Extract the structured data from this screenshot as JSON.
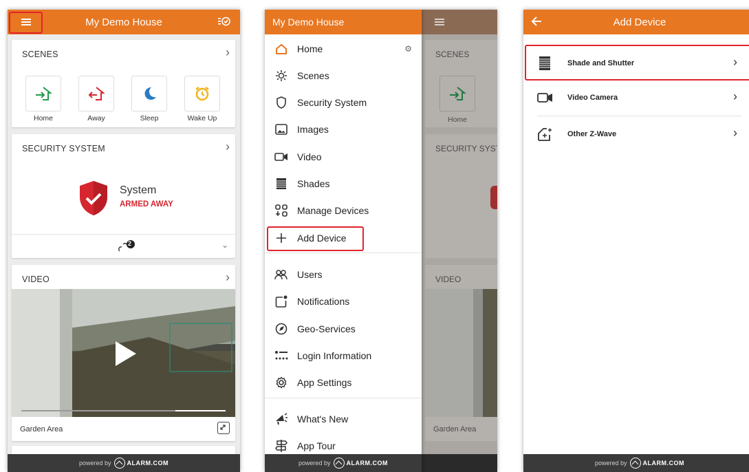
{
  "colors": {
    "brand": "#e87722",
    "armed": "#d6262f",
    "highlight": "#e0242b",
    "scene_green": "#1f9a4a",
    "scene_red": "#d6262f",
    "scene_blue": "#2b7bc4",
    "scene_yellow": "#f2b31b"
  },
  "footer": {
    "powered_by": "powered by",
    "brand": "ALARM.COM"
  },
  "screen1": {
    "title": "My Demo House",
    "icons": {
      "menu": "hamburger-icon",
      "status": "list-check-icon"
    },
    "scenes": {
      "heading": "SCENES",
      "items": [
        {
          "label": "Home",
          "icon": "home-enter-icon"
        },
        {
          "label": "Away",
          "icon": "home-leave-icon"
        },
        {
          "label": "Sleep",
          "icon": "moon-icon"
        },
        {
          "label": "Wake Up",
          "icon": "alarm-clock-icon"
        }
      ]
    },
    "security": {
      "heading": "SECURITY SYSTEM",
      "name": "System",
      "state": "ARMED AWAY",
      "badge": "2"
    },
    "video": {
      "heading": "VIDEO",
      "camera": "Garden Area"
    }
  },
  "screen2": {
    "title": "My Demo House",
    "menu": [
      {
        "label": "Home",
        "icon": "home-icon"
      },
      {
        "label": "Scenes",
        "icon": "scenes-icon"
      },
      {
        "label": "Security System",
        "icon": "shield-icon"
      },
      {
        "label": "Images",
        "icon": "image-icon"
      },
      {
        "label": "Video",
        "icon": "video-camera-icon"
      },
      {
        "label": "Shades",
        "icon": "shade-icon"
      },
      {
        "label": "Manage Devices",
        "icon": "manage-devices-icon"
      },
      {
        "label": "Add Device",
        "icon": "plus-icon"
      },
      {
        "label": "Users",
        "icon": "users-icon"
      },
      {
        "label": "Notifications",
        "icon": "notification-icon"
      },
      {
        "label": "Geo-Services",
        "icon": "compass-icon"
      },
      {
        "label": "Login Information",
        "icon": "login-icon"
      },
      {
        "label": "App Settings",
        "icon": "gear-icon"
      },
      {
        "label": "What's New",
        "icon": "megaphone-icon"
      },
      {
        "label": "App Tour",
        "icon": "signpost-icon"
      }
    ],
    "behind": {
      "scenes": "SCENES",
      "home": "Home",
      "security": "SECURITY SYST",
      "video": "VIDEO",
      "camera": "Garden Area"
    }
  },
  "screen3": {
    "title": "Add Device",
    "items": [
      {
        "label": "Shade and Shutter",
        "icon": "shade-icon"
      },
      {
        "label": "Video Camera",
        "icon": "video-camera-icon"
      },
      {
        "label": "Other Z-Wave",
        "icon": "zwave-add-icon"
      }
    ]
  }
}
